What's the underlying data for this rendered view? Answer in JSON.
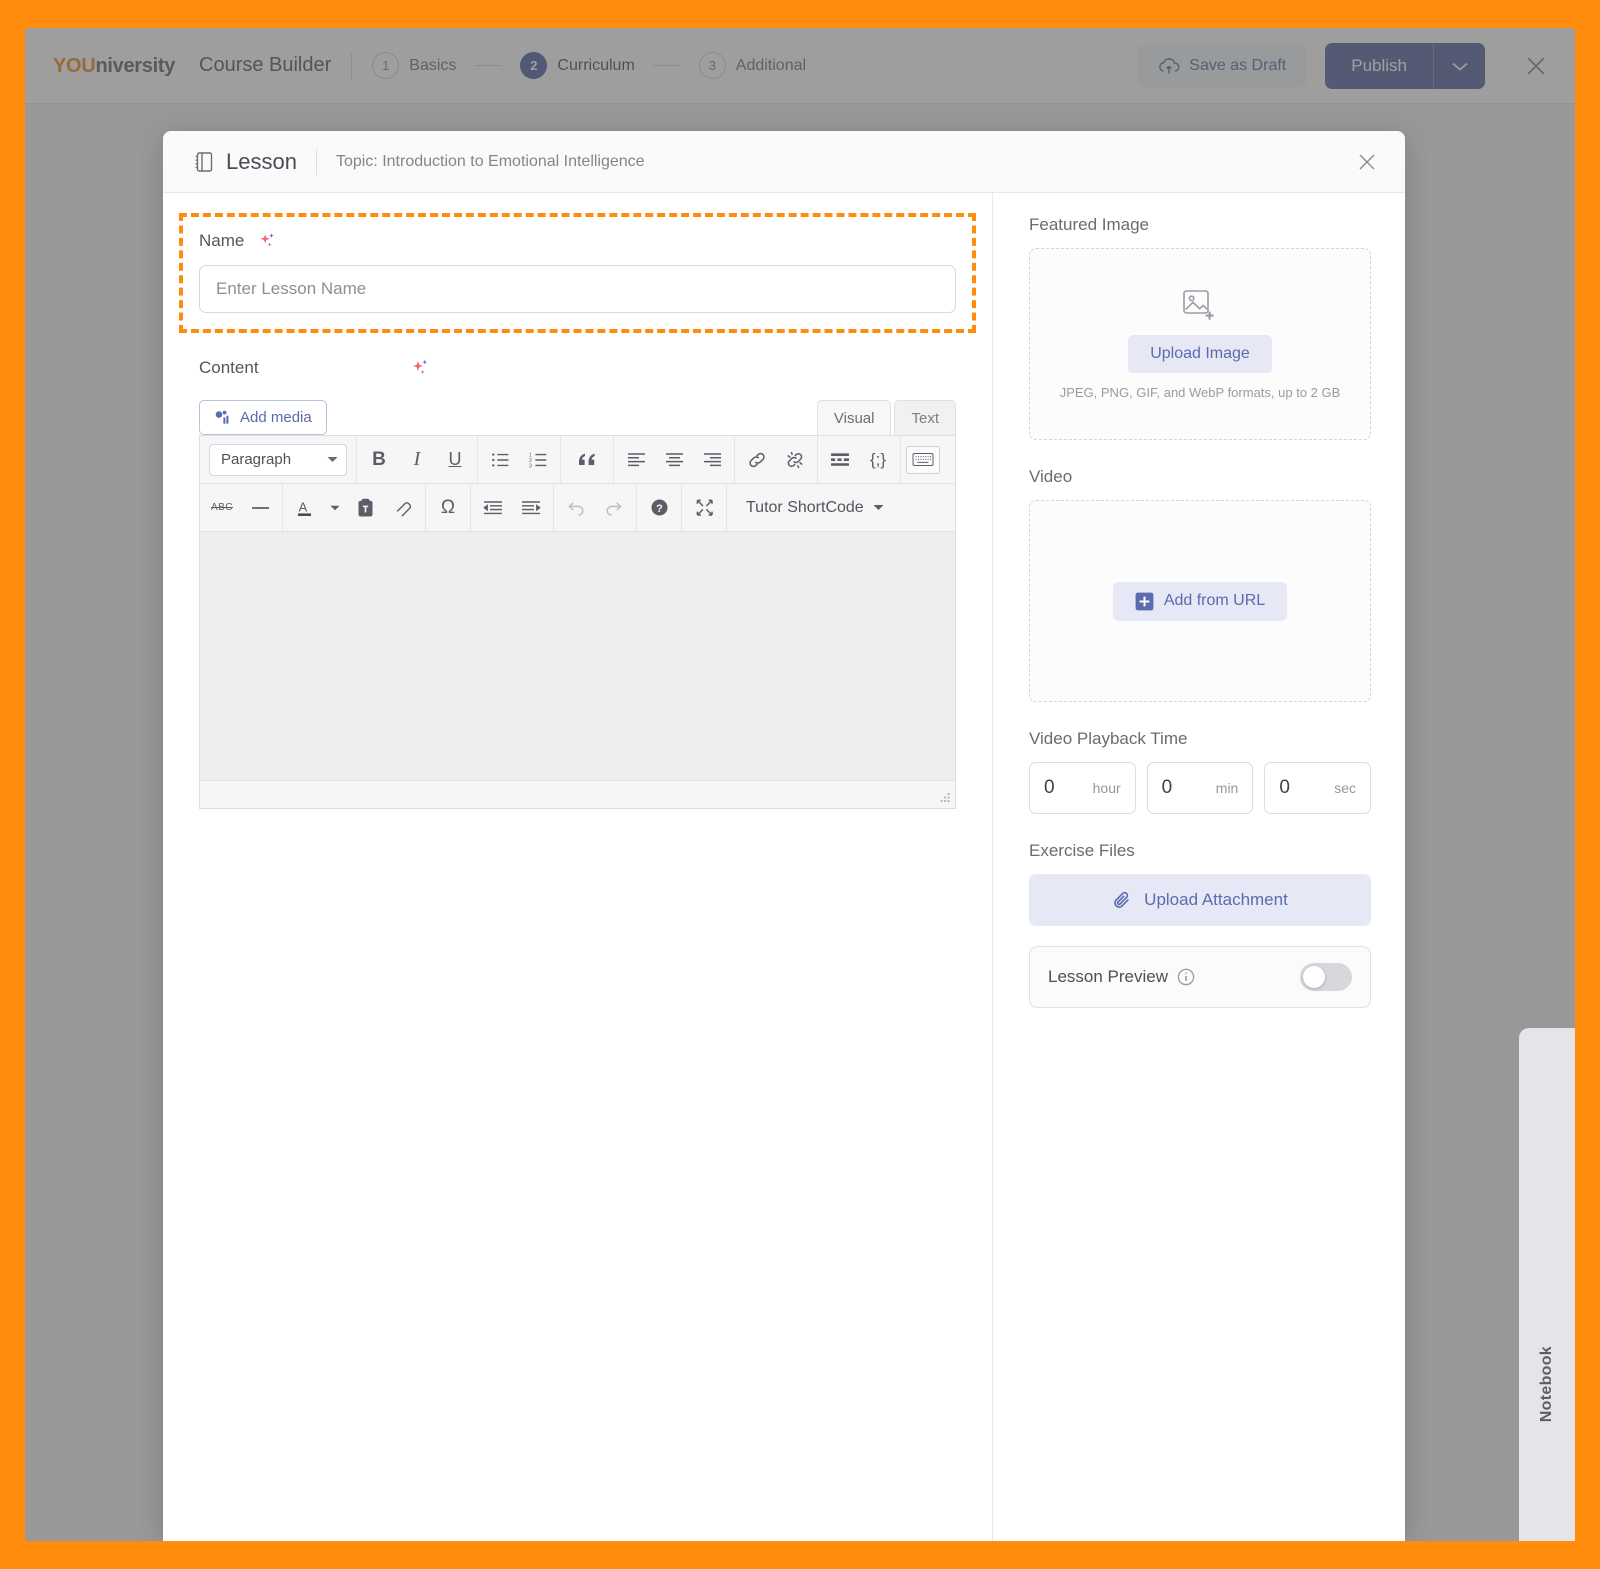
{
  "appbar": {
    "logo_primary": "YOU",
    "logo_secondary": "niversity",
    "title": "Course Builder",
    "steps": [
      {
        "num": "1",
        "label": "Basics",
        "active": false
      },
      {
        "num": "2",
        "label": "Curriculum",
        "active": true
      },
      {
        "num": "3",
        "label": "Additional",
        "active": false
      }
    ],
    "save_draft_label": "Save as Draft",
    "publish_label": "Publish",
    "close_label": "Close"
  },
  "modal": {
    "title": "Lesson",
    "topic": "Topic: Introduction to Emotional Intelligence",
    "close_label": "Close"
  },
  "name_field": {
    "label": "Name",
    "placeholder": "Enter Lesson Name",
    "value": ""
  },
  "content": {
    "label": "Content",
    "add_media_label": "Add media",
    "tabs": [
      {
        "label": "Visual",
        "active": true
      },
      {
        "label": "Text",
        "active": false
      }
    ],
    "toolbar_row1": {
      "format_select": "Paragraph",
      "bold": "B",
      "italic": "I",
      "underline": "U",
      "shortcode_braces": "{;}"
    },
    "toolbar_row2": {
      "strikethrough": "ABC",
      "omega": "Ω",
      "shortcode_label": "Tutor ShortCode"
    },
    "body_text": ""
  },
  "sidebar": {
    "featured_image": {
      "label": "Featured Image",
      "button_label": "Upload Image",
      "hint": "JPEG, PNG, GIF, and WebP formats, up to 2 GB"
    },
    "video": {
      "label": "Video",
      "button_label": "Add from URL"
    },
    "playback_time": {
      "label": "Video Playback Time",
      "fields": [
        {
          "value": "0",
          "unit": "hour"
        },
        {
          "value": "0",
          "unit": "min"
        },
        {
          "value": "0",
          "unit": "sec"
        }
      ]
    },
    "exercise_files": {
      "label": "Exercise Files",
      "button_label": "Upload Attachment"
    },
    "lesson_preview": {
      "label": "Lesson Preview",
      "enabled": false
    }
  },
  "notebook_tab": {
    "label": "Notebook"
  },
  "colors": {
    "highlight": "#ff8c0d",
    "accent_blue": "#5c6ab0",
    "publish_bg": "#6370a3",
    "logo_orange": "#f0912d"
  }
}
